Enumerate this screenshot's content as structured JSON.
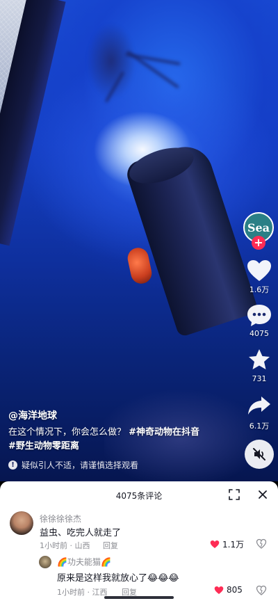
{
  "video": {
    "author": "@海洋地球",
    "caption_text": "在这个情况下，你会怎么做？",
    "hashtag_1": "#神奇动物在抖音",
    "hashtag_2": "#野生动物零距离",
    "warning": "疑似引人不适，请谨慎选择观看"
  },
  "actions": {
    "avatar_text": "Sea",
    "follow": "+",
    "likes": "1.6万",
    "comments": "4075",
    "favorites": "731",
    "shares": "6.1万"
  },
  "colors": {
    "accent": "#fe2c55",
    "avatar_bg": "#2a7f86",
    "sheet_bg": "#ffffff",
    "muted_text": "#8a8b91"
  },
  "comments_sheet": {
    "title": "4075条评论",
    "comments": [
      {
        "user": "徐徐徐徐杰",
        "text": "益虫、吃完人就走了",
        "time_location": "1小时前 · 山西",
        "reply_label": "回复",
        "likes": "1.1万",
        "liked": true
      },
      {
        "user": "🌈功夫能猫🌈",
        "text": "原来是这样我就放心了😂😂😂",
        "time_location": "1小时前 · 江西",
        "reply_label": "回复",
        "likes": "805",
        "liked": true
      }
    ]
  }
}
